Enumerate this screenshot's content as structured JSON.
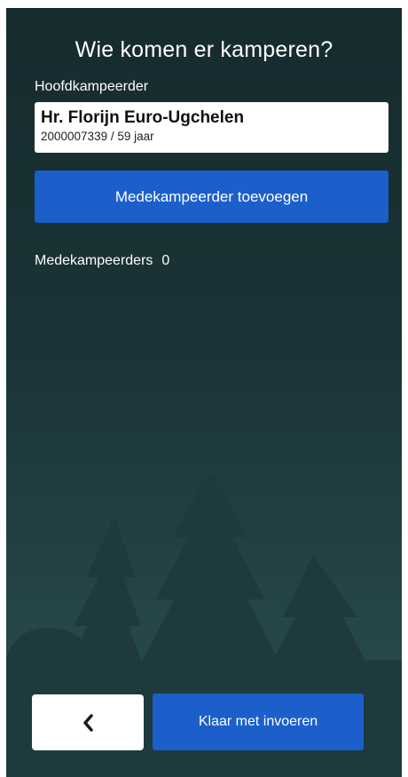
{
  "screen": {
    "title": "Wie komen er kamperen?"
  },
  "main_camper": {
    "label": "Hoofdkampeerder",
    "name": "Hr. Florijn Euro-Ugchelen",
    "details": "2000007339 / 59 jaar"
  },
  "actions": {
    "add_co_camper_label": "Medekampeerder toevoegen",
    "done_label": "Klaar met invoeren",
    "back_icon": "chevron-left-icon"
  },
  "co_campers": {
    "label": "Medekampeerders",
    "count": "0"
  },
  "colors": {
    "background_top": "#162b2e",
    "background_bottom": "#2b5052",
    "primary_button": "#1c5fcb",
    "tree_silhouette": "#1f3a3c"
  }
}
